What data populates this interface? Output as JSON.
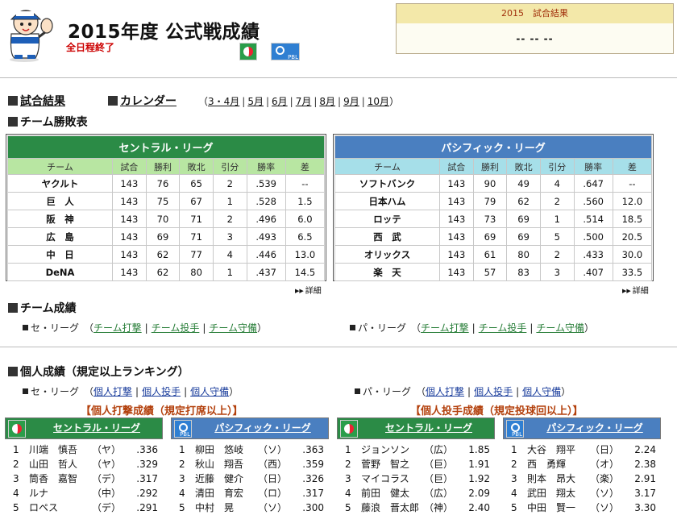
{
  "header": {
    "title": "2015年度",
    "title2": "公式戦成績",
    "status": "全日程終了",
    "result_title": "2015　試合結果",
    "result_value": "-- -- --",
    "central_logo": "central-league-logo",
    "pacific_logo": "pacific-league-logo",
    "pbl": "PBL"
  },
  "nav": {
    "results": "試合結果",
    "calendar": "カレンダー",
    "open": "（",
    "close": "）",
    "months": [
      "3・4月",
      "5月",
      "6月",
      "7月",
      "8月",
      "9月",
      "10月"
    ]
  },
  "standings": {
    "section": "チーム勝敗表",
    "columns": [
      "チーム",
      "試合",
      "勝利",
      "敗北",
      "引分",
      "勝率",
      "差"
    ],
    "central": {
      "label": "セントラル・リーグ",
      "rows": [
        [
          "ヤクルト",
          "143",
          "76",
          "65",
          "2",
          ".539",
          "--"
        ],
        [
          "巨　人",
          "143",
          "75",
          "67",
          "1",
          ".528",
          "1.5"
        ],
        [
          "阪　神",
          "143",
          "70",
          "71",
          "2",
          ".496",
          "6.0"
        ],
        [
          "広　島",
          "143",
          "69",
          "71",
          "3",
          ".493",
          "6.5"
        ],
        [
          "中　日",
          "143",
          "62",
          "77",
          "4",
          ".446",
          "13.0"
        ],
        [
          "DeNA",
          "143",
          "62",
          "80",
          "1",
          ".437",
          "14.5"
        ]
      ]
    },
    "pacific": {
      "label": "パシフィック・リーグ",
      "rows": [
        [
          "ソフトバンク",
          "143",
          "90",
          "49",
          "4",
          ".647",
          "--"
        ],
        [
          "日本ハム",
          "143",
          "79",
          "62",
          "2",
          ".560",
          "12.0"
        ],
        [
          "ロッテ",
          "143",
          "73",
          "69",
          "1",
          ".514",
          "18.5"
        ],
        [
          "西　武",
          "143",
          "69",
          "69",
          "5",
          ".500",
          "20.5"
        ],
        [
          "オリックス",
          "143",
          "61",
          "80",
          "2",
          ".433",
          "30.0"
        ],
        [
          "楽　天",
          "143",
          "57",
          "83",
          "3",
          ".407",
          "33.5"
        ]
      ]
    },
    "more": "詳細"
  },
  "team_stats": {
    "section": "チーム成績",
    "central_label": "セ・リーグ",
    "pacific_label": "パ・リーグ",
    "links": [
      "チーム打撃",
      "チーム投手",
      "チーム守備"
    ]
  },
  "individual": {
    "section": "個人成績（規定以上ランキング）",
    "central_label": "セ・リーグ",
    "pacific_label": "パ・リーグ",
    "links": [
      "個人打撃",
      "個人投手",
      "個人守備"
    ],
    "batting_title": "【個人打撃成績（規定打席以上）】",
    "pitching_title": "【個人投手成績（規定投球回以上）】",
    "boards": [
      {
        "label": "セントラル・リーグ",
        "rows": [
          [
            "1",
            "川端　慎吾",
            "（ヤ）",
            ".336"
          ],
          [
            "2",
            "山田　哲人",
            "（ヤ）",
            ".329"
          ],
          [
            "3",
            "筒香　嘉智",
            "（デ）",
            ".317"
          ],
          [
            "4",
            "ルナ",
            "（中）",
            ".292"
          ],
          [
            "5",
            "ロペス",
            "（デ）",
            ".291"
          ]
        ]
      },
      {
        "label": "パシフィック・リーグ",
        "rows": [
          [
            "1",
            "柳田　悠岐",
            "（ソ）",
            ".363"
          ],
          [
            "2",
            "秋山　翔吾",
            "（西）",
            ".359"
          ],
          [
            "3",
            "近藤　健介",
            "（日）",
            ".326"
          ],
          [
            "4",
            "清田　育宏",
            "（ロ）",
            ".317"
          ],
          [
            "5",
            "中村　晃",
            "（ソ）",
            ".300"
          ]
        ]
      },
      {
        "label": "セントラル・リーグ",
        "rows": [
          [
            "1",
            "ジョンソン",
            "（広）",
            "1.85"
          ],
          [
            "2",
            "菅野　智之",
            "（巨）",
            "1.91"
          ],
          [
            "3",
            "マイコラス",
            "（巨）",
            "1.92"
          ],
          [
            "4",
            "前田　健太",
            "（広）",
            "2.09"
          ],
          [
            "5",
            "藤浪　晋太郎",
            "（神）",
            "2.40"
          ]
        ]
      },
      {
        "label": "パシフィック・リーグ",
        "rows": [
          [
            "1",
            "大谷　翔平",
            "（日）",
            "2.24"
          ],
          [
            "2",
            "西　勇輝",
            "（オ）",
            "2.38"
          ],
          [
            "3",
            "則本　昂大",
            "（楽）",
            "2.91"
          ],
          [
            "4",
            "武田　翔太",
            "（ソ）",
            "3.17"
          ],
          [
            "5",
            "中田　賢一",
            "（ソ）",
            "3.30"
          ]
        ]
      }
    ]
  }
}
